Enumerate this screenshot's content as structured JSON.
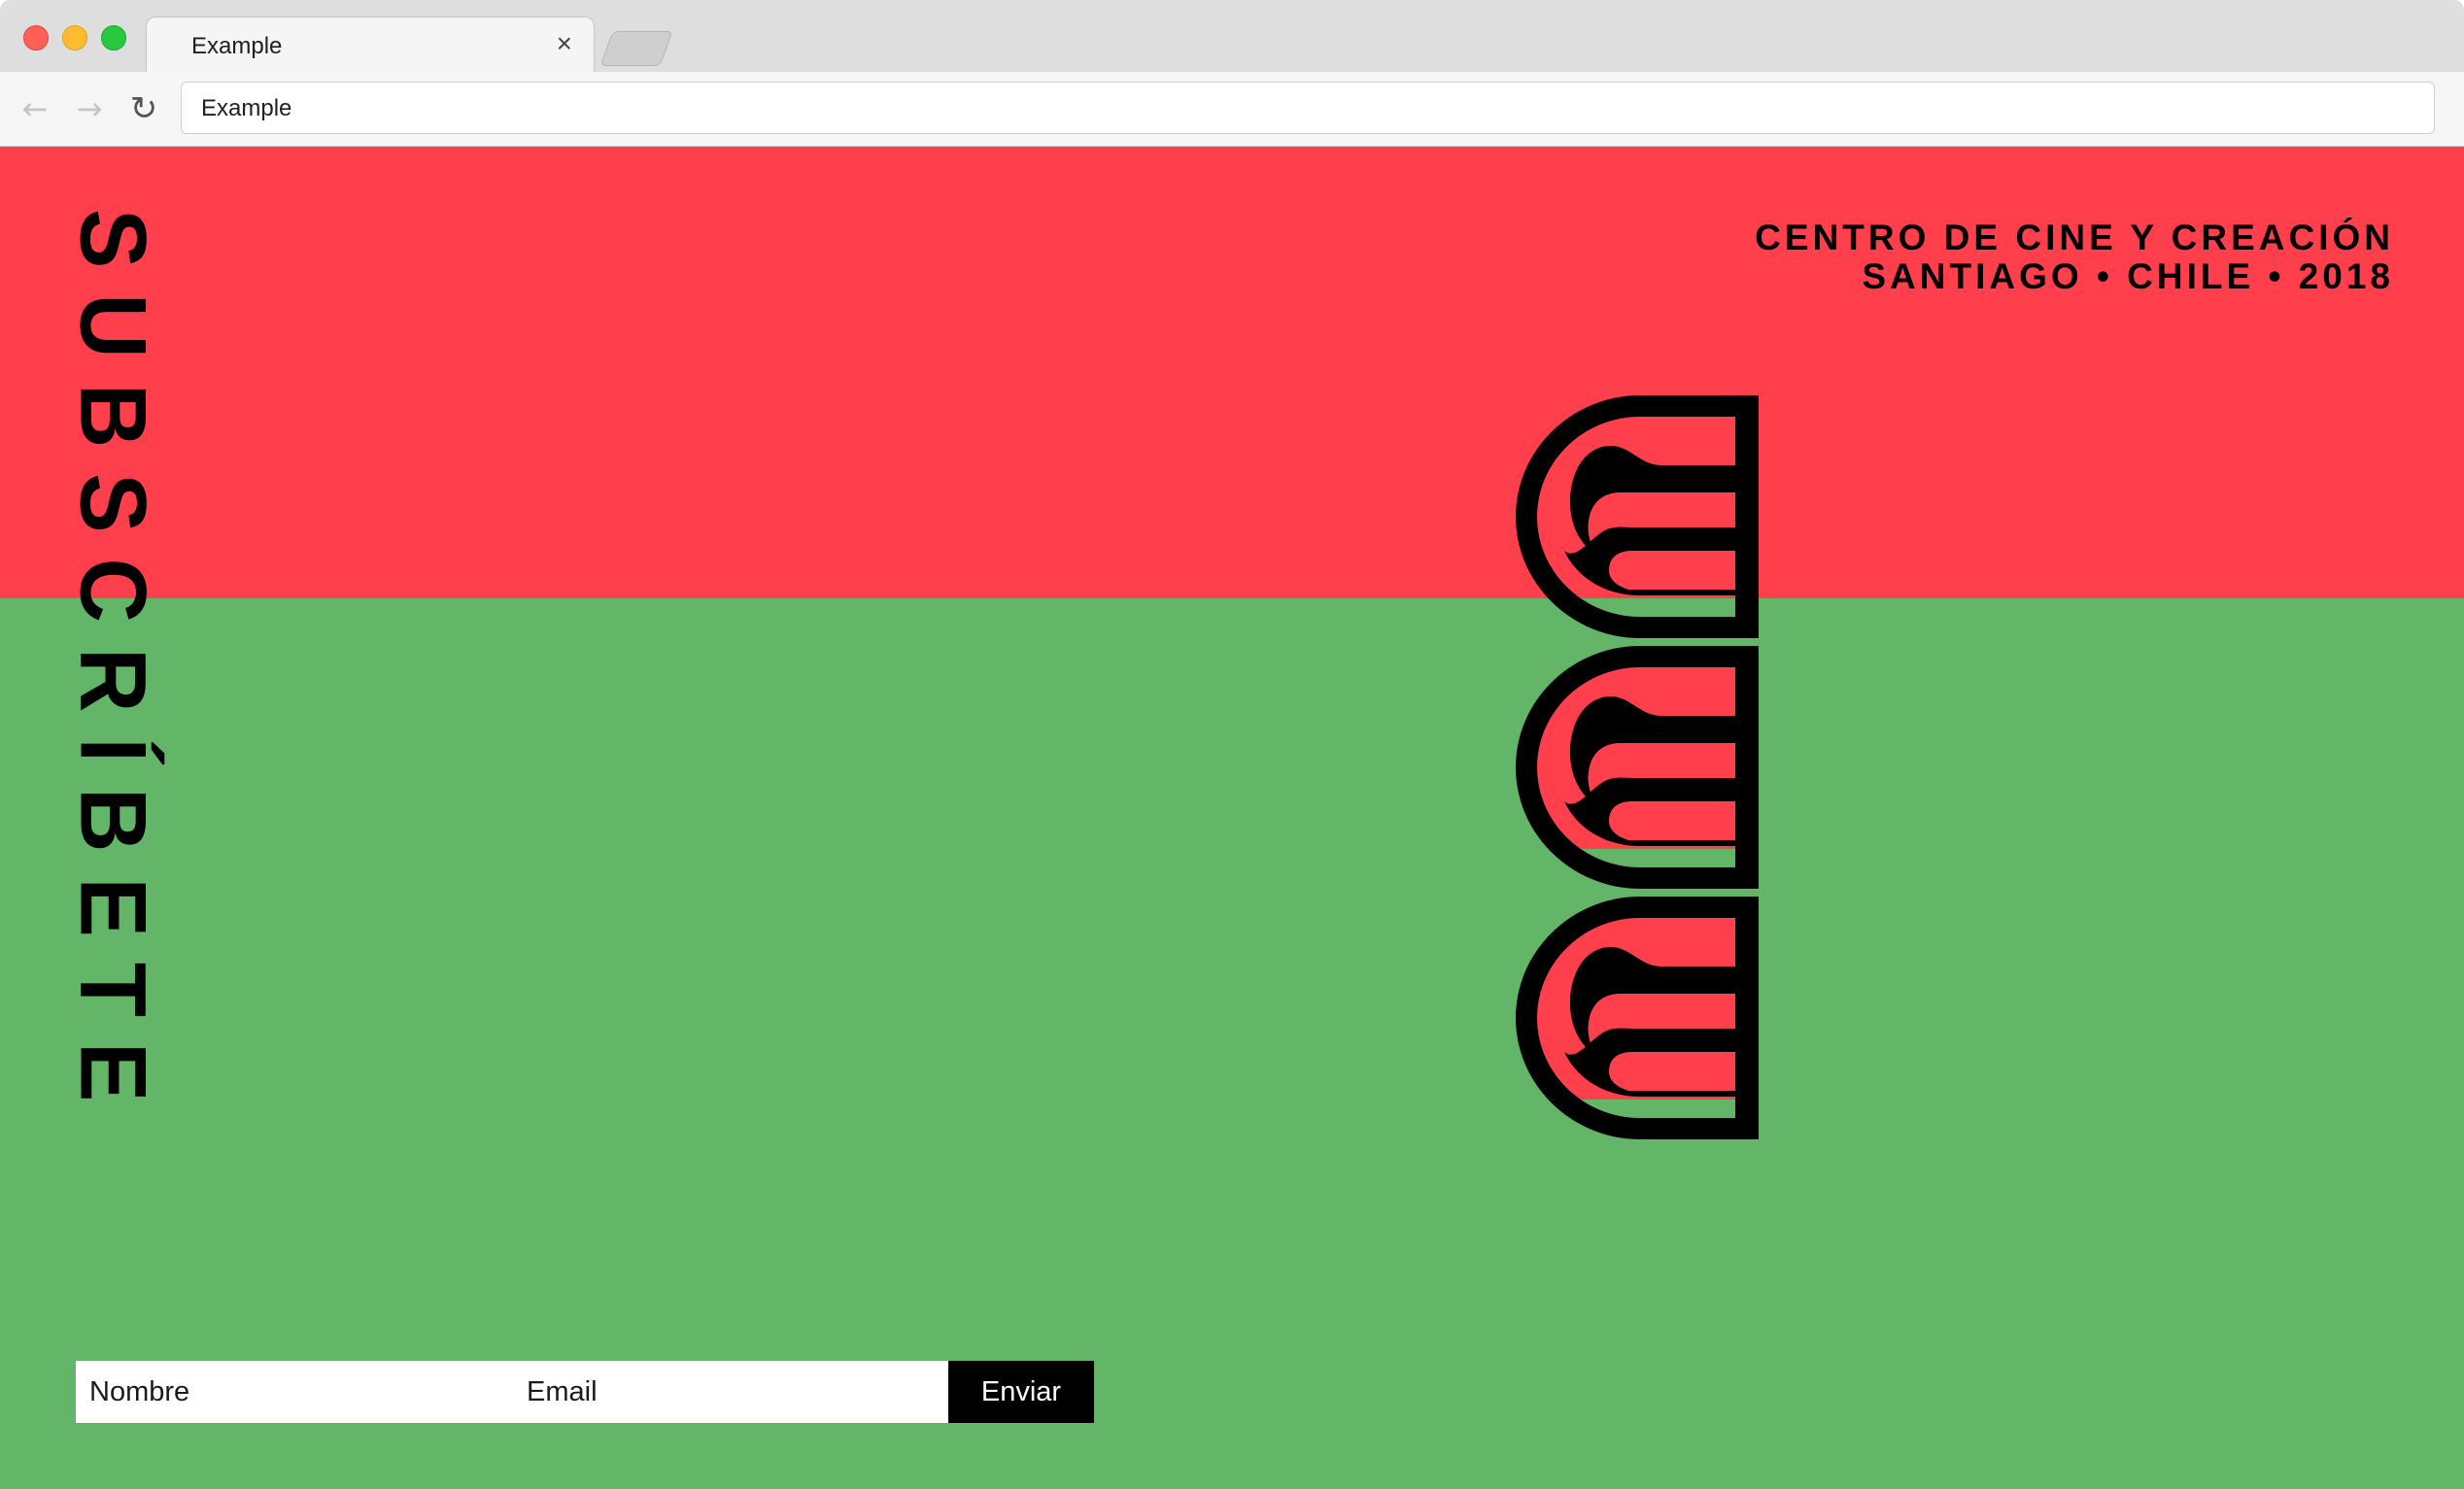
{
  "browser": {
    "tab_title": "Example",
    "tab_close": "×",
    "url": "Example",
    "nav": {
      "back": "←",
      "forward": "→",
      "reload": "↻"
    }
  },
  "page": {
    "colors": {
      "top_band": "#ff3f4c",
      "bottom_band": "#63b567",
      "ink": "#000000"
    },
    "vertical_title": "SUBSCRÍBETE",
    "header_line1": "CENTRO DE CINE Y CREACIÓN",
    "header_line2": "SANTIAGO • CHILE • 2018",
    "logo_name": "triple-u-logo"
  },
  "form": {
    "name_placeholder": "Nombre",
    "email_placeholder": "Email",
    "submit_label": "Enviar"
  }
}
